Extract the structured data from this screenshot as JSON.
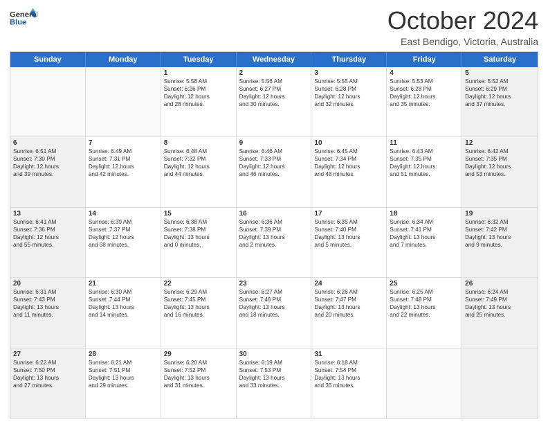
{
  "header": {
    "logo_general": "General",
    "logo_blue": "Blue",
    "title": "October 2024",
    "location": "East Bendigo, Victoria, Australia"
  },
  "weekdays": [
    "Sunday",
    "Monday",
    "Tuesday",
    "Wednesday",
    "Thursday",
    "Friday",
    "Saturday"
  ],
  "rows": [
    [
      {
        "day": "",
        "text": "",
        "empty": true
      },
      {
        "day": "",
        "text": "",
        "empty": true
      },
      {
        "day": "1",
        "text": "Sunrise: 5:58 AM\nSunset: 6:26 PM\nDaylight: 12 hours\nand 28 minutes."
      },
      {
        "day": "2",
        "text": "Sunrise: 5:56 AM\nSunset: 6:27 PM\nDaylight: 12 hours\nand 30 minutes."
      },
      {
        "day": "3",
        "text": "Sunrise: 5:55 AM\nSunset: 6:28 PM\nDaylight: 12 hours\nand 32 minutes."
      },
      {
        "day": "4",
        "text": "Sunrise: 5:53 AM\nSunset: 6:28 PM\nDaylight: 12 hours\nand 35 minutes."
      },
      {
        "day": "5",
        "text": "Sunrise: 5:52 AM\nSunset: 6:29 PM\nDaylight: 12 hours\nand 37 minutes.",
        "shaded": true
      }
    ],
    [
      {
        "day": "6",
        "text": "Sunrise: 6:51 AM\nSunset: 7:30 PM\nDaylight: 12 hours\nand 39 minutes.",
        "shaded": true
      },
      {
        "day": "7",
        "text": "Sunrise: 6:49 AM\nSunset: 7:31 PM\nDaylight: 12 hours\nand 42 minutes."
      },
      {
        "day": "8",
        "text": "Sunrise: 6:48 AM\nSunset: 7:32 PM\nDaylight: 12 hours\nand 44 minutes."
      },
      {
        "day": "9",
        "text": "Sunrise: 6:46 AM\nSunset: 7:33 PM\nDaylight: 12 hours\nand 46 minutes."
      },
      {
        "day": "10",
        "text": "Sunrise: 6:45 AM\nSunset: 7:34 PM\nDaylight: 12 hours\nand 48 minutes."
      },
      {
        "day": "11",
        "text": "Sunrise: 6:43 AM\nSunset: 7:35 PM\nDaylight: 12 hours\nand 51 minutes."
      },
      {
        "day": "12",
        "text": "Sunrise: 6:42 AM\nSunset: 7:35 PM\nDaylight: 12 hours\nand 53 minutes.",
        "shaded": true
      }
    ],
    [
      {
        "day": "13",
        "text": "Sunrise: 6:41 AM\nSunset: 7:36 PM\nDaylight: 12 hours\nand 55 minutes.",
        "shaded": true
      },
      {
        "day": "14",
        "text": "Sunrise: 6:39 AM\nSunset: 7:37 PM\nDaylight: 12 hours\nand 58 minutes."
      },
      {
        "day": "15",
        "text": "Sunrise: 6:38 AM\nSunset: 7:38 PM\nDaylight: 13 hours\nand 0 minutes."
      },
      {
        "day": "16",
        "text": "Sunrise: 6:36 AM\nSunset: 7:39 PM\nDaylight: 13 hours\nand 2 minutes."
      },
      {
        "day": "17",
        "text": "Sunrise: 6:35 AM\nSunset: 7:40 PM\nDaylight: 13 hours\nand 5 minutes."
      },
      {
        "day": "18",
        "text": "Sunrise: 6:34 AM\nSunset: 7:41 PM\nDaylight: 13 hours\nand 7 minutes."
      },
      {
        "day": "19",
        "text": "Sunrise: 6:32 AM\nSunset: 7:42 PM\nDaylight: 13 hours\nand 9 minutes.",
        "shaded": true
      }
    ],
    [
      {
        "day": "20",
        "text": "Sunrise: 6:31 AM\nSunset: 7:43 PM\nDaylight: 13 hours\nand 11 minutes.",
        "shaded": true
      },
      {
        "day": "21",
        "text": "Sunrise: 6:30 AM\nSunset: 7:44 PM\nDaylight: 13 hours\nand 14 minutes."
      },
      {
        "day": "22",
        "text": "Sunrise: 6:29 AM\nSunset: 7:45 PM\nDaylight: 13 hours\nand 16 minutes."
      },
      {
        "day": "23",
        "text": "Sunrise: 6:27 AM\nSunset: 7:46 PM\nDaylight: 13 hours\nand 18 minutes."
      },
      {
        "day": "24",
        "text": "Sunrise: 6:26 AM\nSunset: 7:47 PM\nDaylight: 13 hours\nand 20 minutes."
      },
      {
        "day": "25",
        "text": "Sunrise: 6:25 AM\nSunset: 7:48 PM\nDaylight: 13 hours\nand 22 minutes."
      },
      {
        "day": "26",
        "text": "Sunrise: 6:24 AM\nSunset: 7:49 PM\nDaylight: 13 hours\nand 25 minutes.",
        "shaded": true
      }
    ],
    [
      {
        "day": "27",
        "text": "Sunrise: 6:22 AM\nSunset: 7:50 PM\nDaylight: 13 hours\nand 27 minutes.",
        "shaded": true
      },
      {
        "day": "28",
        "text": "Sunrise: 6:21 AM\nSunset: 7:51 PM\nDaylight: 13 hours\nand 29 minutes."
      },
      {
        "day": "29",
        "text": "Sunrise: 6:20 AM\nSunset: 7:52 PM\nDaylight: 13 hours\nand 31 minutes."
      },
      {
        "day": "30",
        "text": "Sunrise: 6:19 AM\nSunset: 7:53 PM\nDaylight: 13 hours\nand 33 minutes."
      },
      {
        "day": "31",
        "text": "Sunrise: 6:18 AM\nSunset: 7:54 PM\nDaylight: 13 hours\nand 35 minutes."
      },
      {
        "day": "",
        "text": "",
        "empty": true
      },
      {
        "day": "",
        "text": "",
        "empty": true,
        "shaded": true
      }
    ]
  ]
}
